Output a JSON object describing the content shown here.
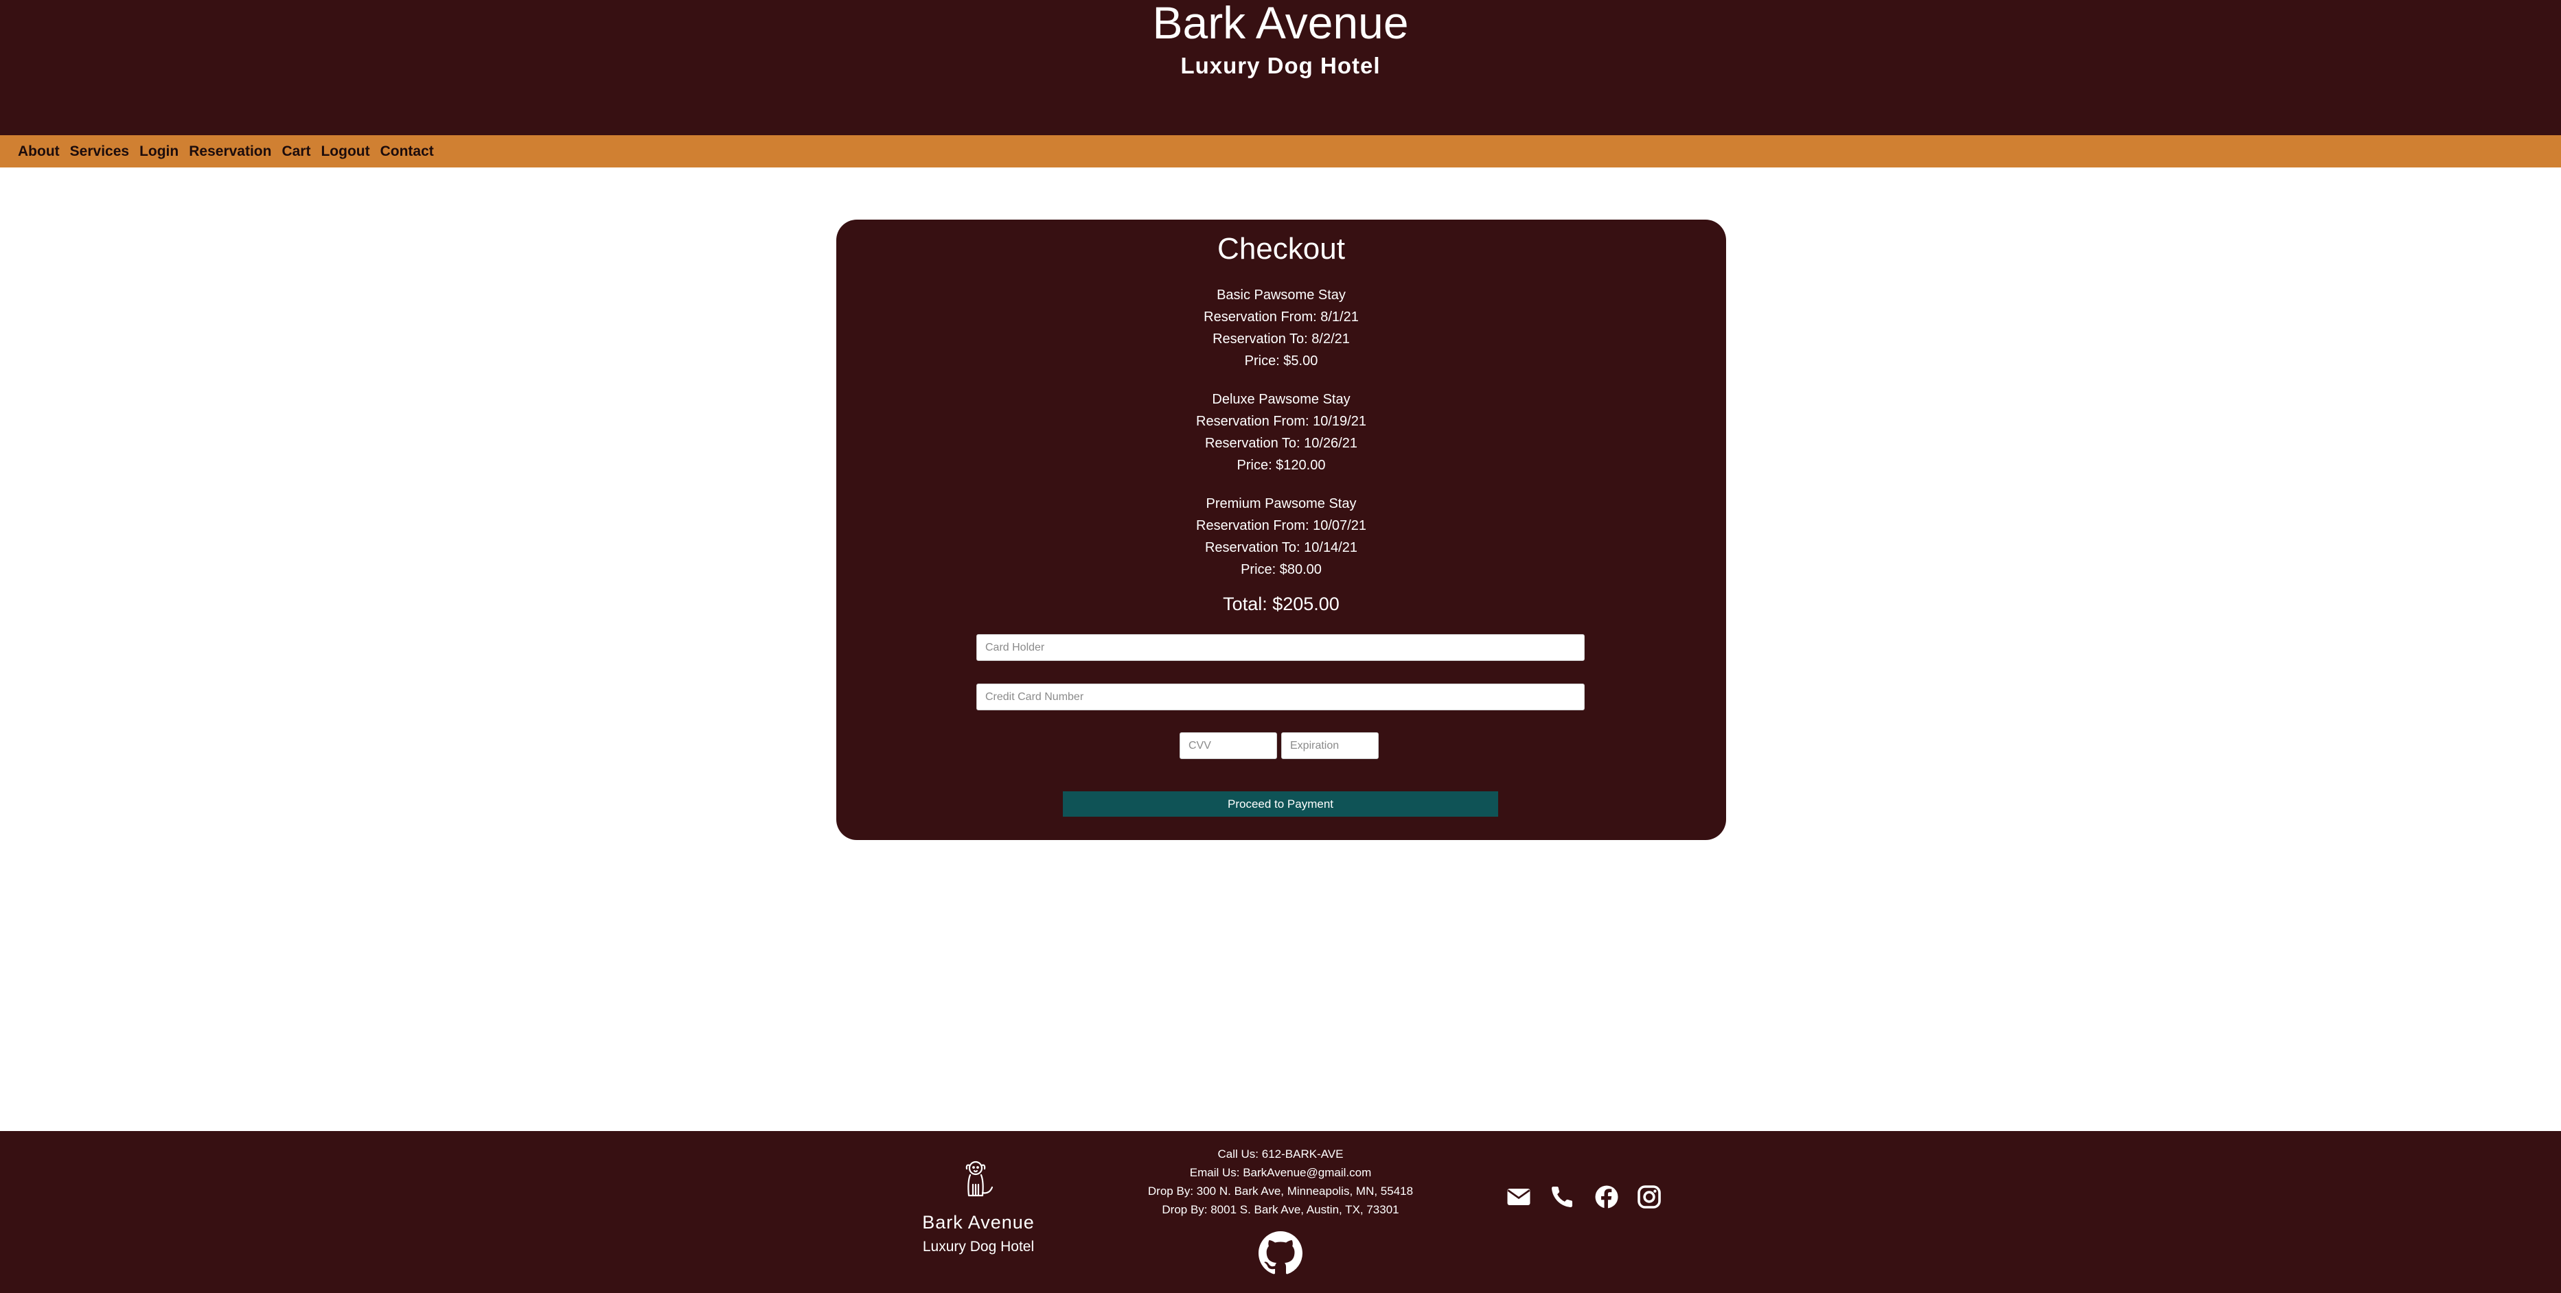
{
  "header": {
    "title": "Bark Avenue",
    "subtitle": "Luxury Dog Hotel"
  },
  "nav": [
    "About",
    "Services",
    "Login",
    "Reservation",
    "Cart",
    "Logout",
    "Contact"
  ],
  "checkout": {
    "title": "Checkout",
    "items": [
      {
        "name": "Basic Pawsome Stay",
        "from": "Reservation From: 8/1/21",
        "to": "Reservation To: 8/2/21",
        "price": "Price: $5.00"
      },
      {
        "name": "Deluxe Pawsome Stay",
        "from": "Reservation From: 10/19/21",
        "to": "Reservation To: 10/26/21",
        "price": "Price: $120.00"
      },
      {
        "name": "Premium Pawsome Stay",
        "from": "Reservation From: 10/07/21",
        "to": "Reservation To: 10/14/21",
        "price": "Price: $80.00"
      }
    ],
    "total": "Total: $205.00",
    "form": {
      "card_holder_placeholder": "Card Holder",
      "card_number_placeholder": "Credit Card Number",
      "cvv_placeholder": "CVV",
      "expiration_placeholder": "Expiration",
      "submit_label": "Proceed to Payment"
    }
  },
  "footer": {
    "brand_name": "Bark Avenue",
    "brand_tag": "Luxury Dog Hotel",
    "contact": [
      "Call Us: 612-BARK-AVE",
      "Email Us: BarkAvenue@gmail.com",
      "Drop By: 300 N. Bark Ave, Minneapolis, MN, 55418",
      "Drop By: 8001 S. Bark Ave, Austin, TX, 73301"
    ],
    "social_icons": [
      "envelope-icon",
      "phone-icon",
      "facebook-icon",
      "instagram-icon"
    ],
    "github_icon": "github-icon"
  },
  "colors": {
    "header_bg": "#371012",
    "nav_bg": "#d08032",
    "card_bg": "#371012",
    "button_bg": "#0f5356"
  }
}
